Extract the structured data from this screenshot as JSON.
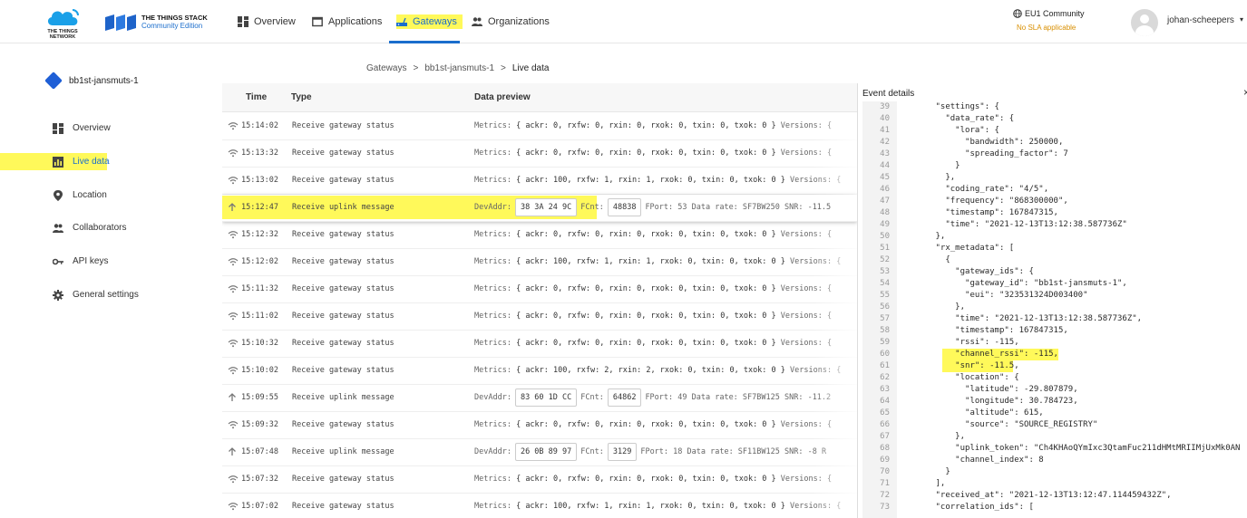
{
  "header": {
    "ttn_logo_text": "THE THINGS NETWORK",
    "tts_title": "THE THINGS STACK",
    "tts_edition": "Community Edition",
    "nav": [
      {
        "label": "Overview",
        "icon": "dashboard-icon"
      },
      {
        "label": "Applications",
        "icon": "app-window-icon"
      },
      {
        "label": "Gateways",
        "icon": "router-icon"
      },
      {
        "label": "Organizations",
        "icon": "people-icon"
      }
    ],
    "region": "EU1 Community",
    "sla": "No SLA applicable",
    "username": "johan-scheepers",
    "colors": {
      "accent": "#1a6dcc",
      "highlight": "#fff95a",
      "sla": "#d98f00"
    }
  },
  "sidebar": {
    "gateway_name": "bb1st-jansmuts-1",
    "items": [
      {
        "label": "Overview",
        "icon": "dashboard-icon"
      },
      {
        "label": "Live data",
        "icon": "chart-icon"
      },
      {
        "label": "Location",
        "icon": "location-pin-icon"
      },
      {
        "label": "Collaborators",
        "icon": "people-icon"
      },
      {
        "label": "API keys",
        "icon": "key-icon"
      },
      {
        "label": "General settings",
        "icon": "gear-icon"
      }
    ]
  },
  "breadcrumb": [
    "Gateways",
    ">",
    "bb1st-jansmuts-1",
    ">",
    "Live data"
  ],
  "table": {
    "headers": {
      "time": "Time",
      "type": "Type",
      "preview": "Data preview"
    },
    "status_preview_label": "Metrics:",
    "versions_label": "Versions: {",
    "rows": [
      {
        "time": "15:14:02",
        "type": "Receive gateway status",
        "kind": "status",
        "metrics": "{ ackr: 0, rxfw: 0, rxin: 0, rxok: 0, txin: 0, txok: 0 }"
      },
      {
        "time": "15:13:32",
        "type": "Receive gateway status",
        "kind": "status",
        "metrics": "{ ackr: 0, rxfw: 0, rxin: 0, rxok: 0, txin: 0, txok: 0 }"
      },
      {
        "time": "15:13:02",
        "type": "Receive gateway status",
        "kind": "status",
        "metrics": "{ ackr: 100, rxfw: 1, rxin: 1, rxok: 0, txin: 0, txok: 0 }"
      },
      {
        "time": "15:12:47",
        "type": "Receive uplink message",
        "kind": "uplink",
        "devaddr": "38 3A 24 9C",
        "fcnt": "48838",
        "fport": "FPort: 53",
        "rate": "Data rate: SF7BW250",
        "snr": "SNR: -11.5"
      },
      {
        "time": "15:12:32",
        "type": "Receive gateway status",
        "kind": "status",
        "metrics": "{ ackr: 0, rxfw: 0, rxin: 0, rxok: 0, txin: 0, txok: 0 }"
      },
      {
        "time": "15:12:02",
        "type": "Receive gateway status",
        "kind": "status",
        "metrics": "{ ackr: 100, rxfw: 1, rxin: 1, rxok: 0, txin: 0, txok: 0 }"
      },
      {
        "time": "15:11:32",
        "type": "Receive gateway status",
        "kind": "status",
        "metrics": "{ ackr: 0, rxfw: 0, rxin: 0, rxok: 0, txin: 0, txok: 0 }"
      },
      {
        "time": "15:11:02",
        "type": "Receive gateway status",
        "kind": "status",
        "metrics": "{ ackr: 0, rxfw: 0, rxin: 0, rxok: 0, txin: 0, txok: 0 }"
      },
      {
        "time": "15:10:32",
        "type": "Receive gateway status",
        "kind": "status",
        "metrics": "{ ackr: 0, rxfw: 0, rxin: 0, rxok: 0, txin: 0, txok: 0 }"
      },
      {
        "time": "15:10:02",
        "type": "Receive gateway status",
        "kind": "status",
        "metrics": "{ ackr: 100, rxfw: 2, rxin: 2, rxok: 0, txin: 0, txok: 0 }"
      },
      {
        "time": "15:09:55",
        "type": "Receive uplink message",
        "kind": "uplink",
        "devaddr": "83 60 1D CC",
        "fcnt": "64862",
        "fport": "FPort: 49",
        "rate": "Data rate: SF7BW125",
        "snr": "SNR: -11.2"
      },
      {
        "time": "15:09:32",
        "type": "Receive gateway status",
        "kind": "status",
        "metrics": "{ ackr: 0, rxfw: 0, rxin: 0, rxok: 0, txin: 0, txok: 0 }"
      },
      {
        "time": "15:07:48",
        "type": "Receive uplink message",
        "kind": "uplink",
        "devaddr": "26 0B 89 97",
        "fcnt": "3129",
        "fport": "FPort: 18",
        "rate": "Data rate: SF11BW125",
        "snr": "SNR: -8 R"
      },
      {
        "time": "15:07:32",
        "type": "Receive gateway status",
        "kind": "status",
        "metrics": "{ ackr: 0, rxfw: 0, rxin: 0, rxok: 0, txin: 0, txok: 0 }"
      },
      {
        "time": "15:07:02",
        "type": "Receive gateway status",
        "kind": "status",
        "metrics": "{ ackr: 100, rxfw: 1, rxin: 1, rxok: 0, txin: 0, txok: 0 }"
      }
    ],
    "devaddr_label": "DevAddr:",
    "fcnt_label": "FCnt:"
  },
  "event_details": {
    "title": "Event details",
    "close": "×",
    "lines": [
      {
        "n": "39",
        "t": "      \"settings\": {"
      },
      {
        "n": "40",
        "t": "        \"data_rate\": {"
      },
      {
        "n": "41",
        "t": "          \"lora\": {"
      },
      {
        "n": "42",
        "t": "            \"bandwidth\": 250000,"
      },
      {
        "n": "43",
        "t": "            \"spreading_factor\": 7"
      },
      {
        "n": "44",
        "t": "          }"
      },
      {
        "n": "45",
        "t": "        },"
      },
      {
        "n": "46",
        "t": "        \"coding_rate\": \"4/5\","
      },
      {
        "n": "47",
        "t": "        \"frequency\": \"868300000\","
      },
      {
        "n": "48",
        "t": "        \"timestamp\": 167847315,"
      },
      {
        "n": "49",
        "t": "        \"time\": \"2021-12-13T13:12:38.587736Z\""
      },
      {
        "n": "50",
        "t": "      },"
      },
      {
        "n": "51",
        "t": "      \"rx_metadata\": ["
      },
      {
        "n": "52",
        "t": "        {"
      },
      {
        "n": "53",
        "t": "          \"gateway_ids\": {"
      },
      {
        "n": "54",
        "t": "            \"gateway_id\": \"bb1st-jansmuts-1\","
      },
      {
        "n": "55",
        "t": "            \"eui\": \"323531324D003400\""
      },
      {
        "n": "56",
        "t": "          },"
      },
      {
        "n": "57",
        "t": "          \"time\": \"2021-12-13T13:12:38.587736Z\","
      },
      {
        "n": "58",
        "t": "          \"timestamp\": 167847315,"
      },
      {
        "n": "59",
        "t": "          \"rssi\": -115,"
      },
      {
        "n": "60",
        "t": "          \"channel_rssi\": -115,"
      },
      {
        "n": "61",
        "t": "          \"snr\": -11.5,"
      },
      {
        "n": "62",
        "t": "          \"location\": {"
      },
      {
        "n": "63",
        "t": "            \"latitude\": -29.807879,"
      },
      {
        "n": "64",
        "t": "            \"longitude\": 30.784723,"
      },
      {
        "n": "65",
        "t": "            \"altitude\": 615,"
      },
      {
        "n": "66",
        "t": "            \"source\": \"SOURCE_REGISTRY\""
      },
      {
        "n": "67",
        "t": "          },"
      },
      {
        "n": "68",
        "t": "          \"uplink_token\": \"Ch4KHAoQYmIxc3QtamFuc211dHMtMRIIMjUxMk0AN"
      },
      {
        "n": "69",
        "t": "          \"channel_index\": 8"
      },
      {
        "n": "70",
        "t": "        }"
      },
      {
        "n": "71",
        "t": "      ],"
      },
      {
        "n": "72",
        "t": "      \"received_at\": \"2021-12-13T13:12:47.114459432Z\","
      },
      {
        "n": "73",
        "t": "      \"correlation_ids\": ["
      }
    ]
  }
}
